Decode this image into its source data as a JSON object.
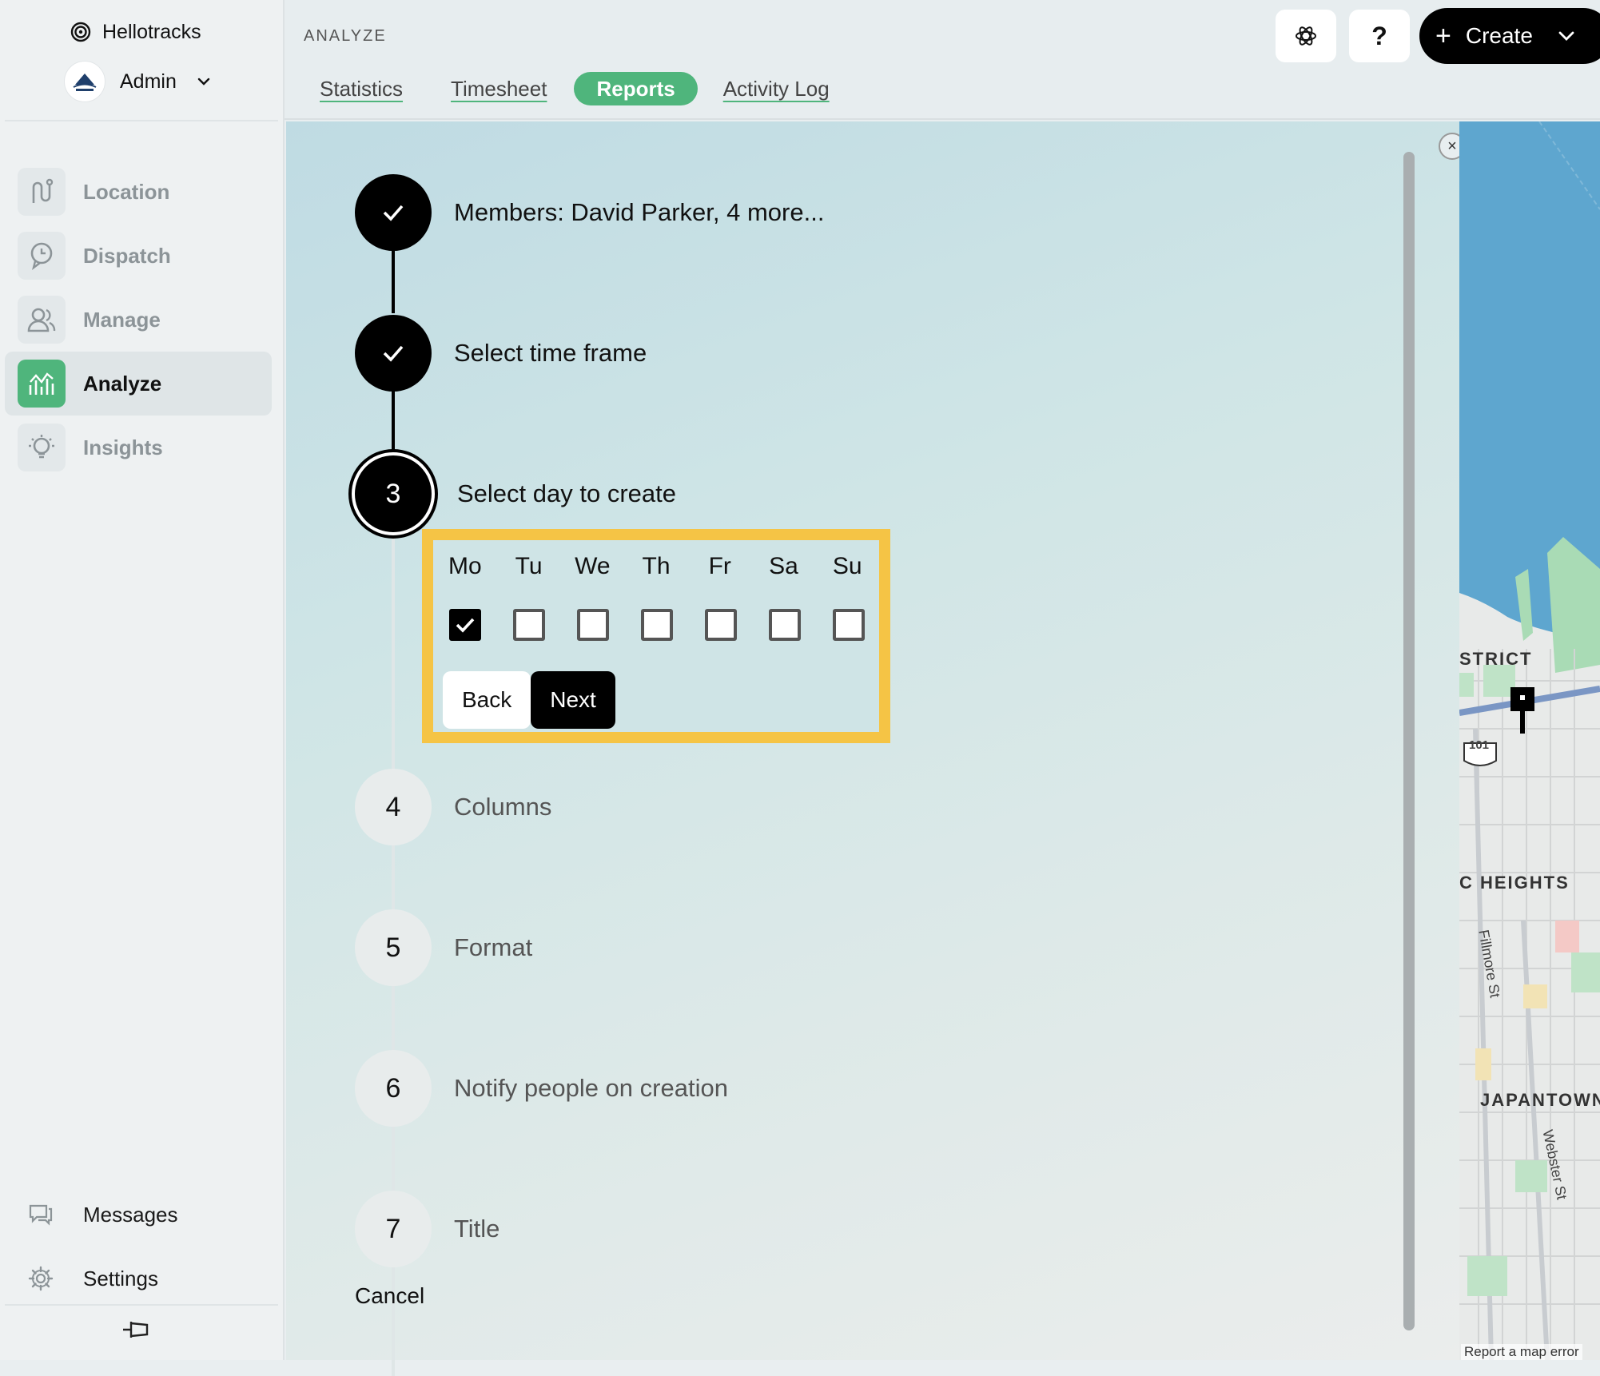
{
  "brand": {
    "name": "Hellotracks",
    "icon": "spiral-logo-icon"
  },
  "account": {
    "name": "Admin",
    "avatar": "bayview-logo",
    "chevron_icon": "chevron-down-icon"
  },
  "nav": {
    "items": [
      {
        "label": "Location",
        "icon": "route-icon",
        "active": false
      },
      {
        "label": "Dispatch",
        "icon": "clock-bubble-icon",
        "active": false
      },
      {
        "label": "Manage",
        "icon": "users-icon",
        "active": false
      },
      {
        "label": "Analyze",
        "icon": "chart-icon",
        "active": true
      },
      {
        "label": "Insights",
        "icon": "lightbulb-icon",
        "active": false
      }
    ],
    "bottom": [
      {
        "label": "Messages",
        "icon": "chat-icon"
      },
      {
        "label": "Settings",
        "icon": "gear-icon"
      }
    ]
  },
  "header": {
    "section": "ANALYZE",
    "tabs": [
      {
        "label": "Statistics",
        "active": false
      },
      {
        "label": "Timesheet",
        "active": false
      },
      {
        "label": "Reports",
        "active": true
      },
      {
        "label": "Activity Log",
        "active": false
      }
    ],
    "help_label": "?",
    "create_label": "Create",
    "create_plus": "+"
  },
  "wizard": {
    "steps": [
      {
        "marker": "✓",
        "label": "Members: David Parker, 4 more...",
        "state": "done"
      },
      {
        "marker": "✓",
        "label": "Select time frame",
        "state": "done"
      },
      {
        "marker": "3",
        "label": "Select day to create",
        "state": "current"
      },
      {
        "marker": "4",
        "label": "Columns",
        "state": "todo"
      },
      {
        "marker": "5",
        "label": "Format",
        "state": "todo"
      },
      {
        "marker": "6",
        "label": "Notify people on creation",
        "state": "todo"
      },
      {
        "marker": "7",
        "label": "Title",
        "state": "todo"
      }
    ],
    "days": [
      {
        "label": "Mo",
        "checked": true
      },
      {
        "label": "Tu",
        "checked": false
      },
      {
        "label": "We",
        "checked": false
      },
      {
        "label": "Th",
        "checked": false
      },
      {
        "label": "Fr",
        "checked": false
      },
      {
        "label": "Sa",
        "checked": false
      },
      {
        "label": "Su",
        "checked": false
      }
    ],
    "back_label": "Back",
    "next_label": "Next",
    "cancel_label": "Cancel",
    "highlight_color": "#f5c445"
  },
  "map": {
    "labels": [
      "STRICT",
      "C HEIGHTS",
      "JAPANTOWN"
    ],
    "streets": [
      "Fillmore St",
      "Webster St"
    ],
    "highway_shield": "101",
    "footer": "Report a map error"
  },
  "colors": {
    "accent": "#4fb57c",
    "dark": "#000000"
  }
}
